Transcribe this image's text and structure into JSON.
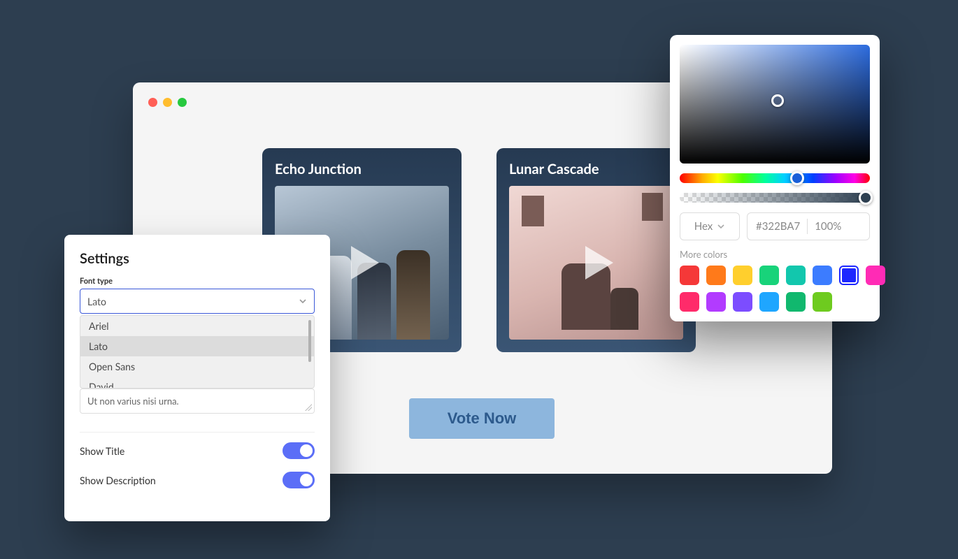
{
  "browser": {
    "cards": [
      {
        "title": "Echo Junction"
      },
      {
        "title": "Lunar Cascade"
      }
    ],
    "vote_label": "Vote Now"
  },
  "settings": {
    "title": "Settings",
    "font_label": "Font type",
    "font_selected": "Lato",
    "font_options": [
      "Ariel",
      "Lato",
      "Open Sans",
      "David"
    ],
    "text_value": "Ut non varius nisi urna.",
    "toggle_title_label": "Show Title",
    "toggle_title_on": true,
    "toggle_desc_label": "Show Description",
    "toggle_desc_on": true
  },
  "picker": {
    "format": "Hex",
    "hex": "#322BA7",
    "alpha": "100%",
    "more_label": "More colors",
    "swatches_row1": [
      "#f53838",
      "#ff7a1a",
      "#ffcf2d",
      "#18d37a",
      "#12c7ad",
      "#3c7cff",
      "#1e27ff"
    ],
    "swatches_row2": [
      "#ff2bb5",
      "#ff2b6a",
      "#b23bff",
      "#7c4dff",
      "#1fa6ff",
      "#11b86e",
      "#6ecb1f"
    ],
    "selected_swatch": "#1e27ff"
  }
}
